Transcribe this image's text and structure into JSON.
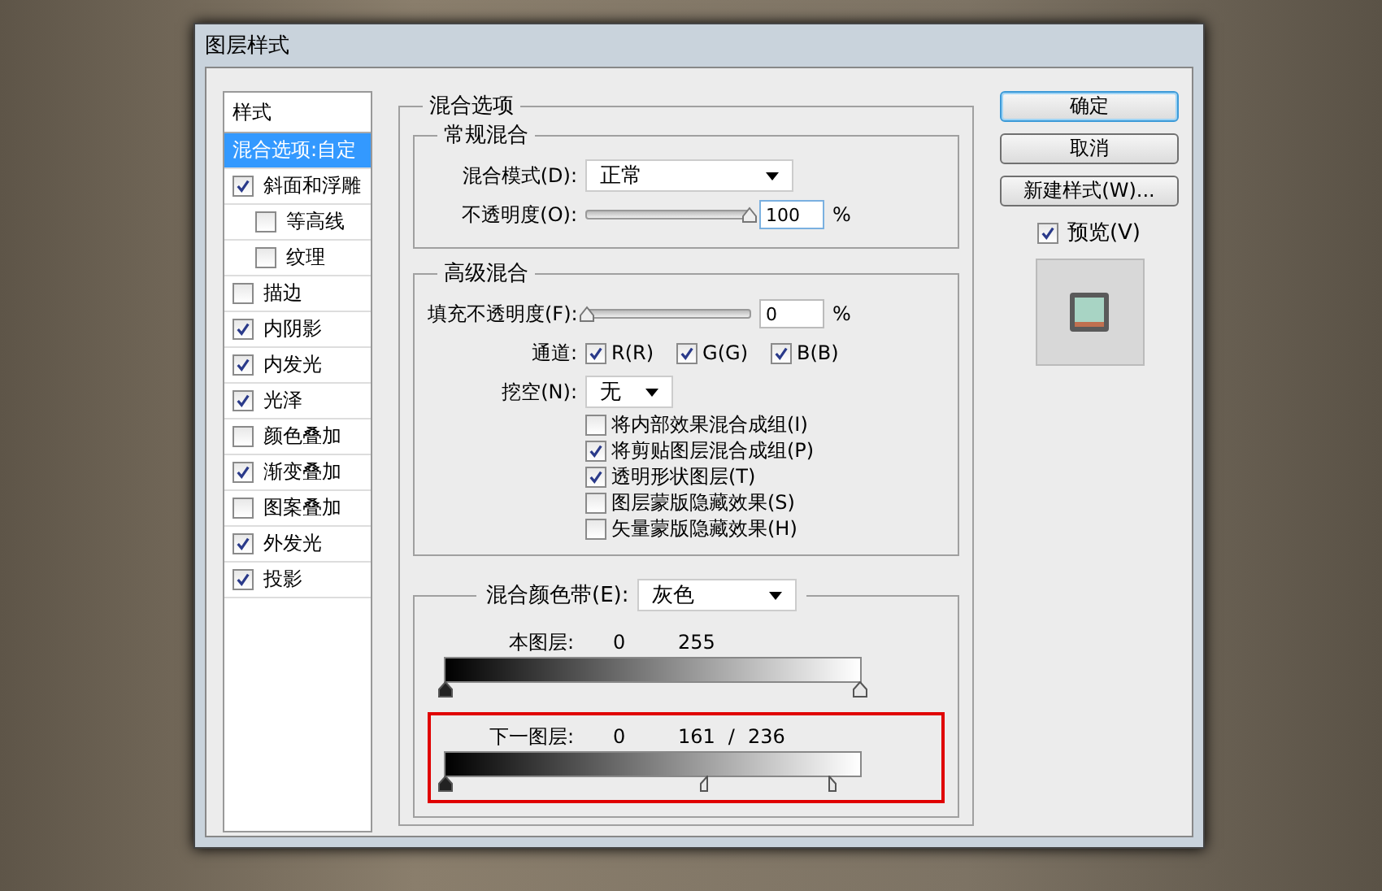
{
  "window": {
    "title": "图层样式"
  },
  "styles_list": {
    "header": "样式",
    "items": [
      {
        "label": "混合选项:自定",
        "kind": "option",
        "selected": true
      },
      {
        "label": "斜面和浮雕",
        "kind": "check",
        "checked": true,
        "selected": false,
        "children": [
          {
            "label": "等高线",
            "kind": "check",
            "checked": false,
            "selected": false
          },
          {
            "label": "纹理",
            "kind": "check",
            "checked": false,
            "selected": false
          }
        ]
      },
      {
        "label": "描边",
        "kind": "check",
        "checked": false,
        "selected": false
      },
      {
        "label": "内阴影",
        "kind": "check",
        "checked": true,
        "selected": false
      },
      {
        "label": "内发光",
        "kind": "check",
        "checked": true,
        "selected": false
      },
      {
        "label": "光泽",
        "kind": "check",
        "checked": true,
        "selected": false
      },
      {
        "label": "颜色叠加",
        "kind": "check",
        "checked": false,
        "selected": false
      },
      {
        "label": "渐变叠加",
        "kind": "check",
        "checked": true,
        "selected": false
      },
      {
        "label": "图案叠加",
        "kind": "check",
        "checked": false,
        "selected": false
      },
      {
        "label": "外发光",
        "kind": "check",
        "checked": true,
        "selected": false
      },
      {
        "label": "投影",
        "kind": "check",
        "checked": true,
        "selected": false
      }
    ]
  },
  "blending_options": {
    "title": "混合选项",
    "general": {
      "title": "常规混合",
      "blend_mode": {
        "label": "混合模式(D):",
        "value": "正常"
      },
      "opacity": {
        "label": "不透明度(O):",
        "level": 1,
        "value": "100",
        "focused": true,
        "unit": "%"
      }
    },
    "advanced": {
      "title": "高级混合",
      "fill_opacity": {
        "label": "填充不透明度(F):",
        "level": 0,
        "value": "0",
        "focused": false,
        "unit": "%"
      },
      "channels": {
        "label": "通道:",
        "items": [
          {
            "label": "R(R)",
            "checked": true
          },
          {
            "label": "G(G)",
            "checked": true
          },
          {
            "label": "B(B)",
            "checked": true
          }
        ]
      },
      "knockout": {
        "label": "挖空(N):",
        "value": "无"
      },
      "options": [
        {
          "label": "将内部效果混合成组(I)",
          "checked": false
        },
        {
          "label": "将剪贴图层混合成组(P)",
          "checked": true
        },
        {
          "label": "透明形状图层(T)",
          "checked": true
        },
        {
          "label": "图层蒙版隐藏效果(S)",
          "checked": false
        },
        {
          "label": "矢量蒙版隐藏效果(H)",
          "checked": false
        }
      ]
    },
    "blend_if": {
      "label": "混合颜色带(E):",
      "value": "灰色",
      "bands": [
        {
          "label": "本图层:",
          "low": "0",
          "high": "255",
          "highlighted": false,
          "handles": [
            {
              "kind": "dark",
              "level": 0
            },
            {
              "kind": "light",
              "level": 1
            }
          ]
        },
        {
          "label": "下一图层:",
          "low": "0",
          "high": "161",
          "separator": "/",
          "high_2": "236",
          "highlighted": true,
          "handles": [
            {
              "kind": "dark",
              "level": 0
            },
            {
              "kind": "split-left",
              "level": 0.631
            },
            {
              "kind": "split-right",
              "level": 0.925
            }
          ]
        }
      ]
    }
  },
  "buttons": [
    {
      "label": "确定",
      "default": true
    },
    {
      "label": "取消",
      "default": false
    },
    {
      "label": "新建样式(W)...",
      "default": false
    }
  ],
  "preview": {
    "label": "预览(V)",
    "checked": true
  }
}
